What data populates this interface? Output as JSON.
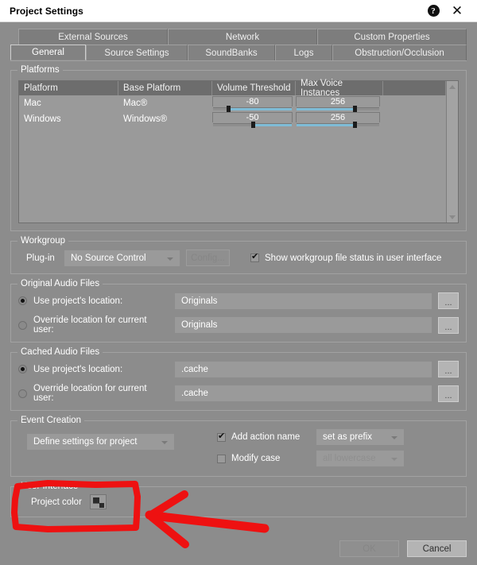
{
  "window": {
    "title": "Project Settings",
    "help_icon": "help-circle-icon",
    "help_label": "?",
    "close_label": "✕"
  },
  "tabs": {
    "row1": [
      {
        "label": "External Sources",
        "active": false
      },
      {
        "label": "Network",
        "active": false
      },
      {
        "label": "Custom Properties",
        "active": false
      }
    ],
    "row2": [
      {
        "label": "General",
        "active": true
      },
      {
        "label": "Source Settings",
        "active": false
      },
      {
        "label": "SoundBanks",
        "active": false
      },
      {
        "label": "Logs",
        "active": false
      },
      {
        "label": "Obstruction/Occlusion",
        "active": false
      }
    ]
  },
  "platforms": {
    "legend": "Platforms",
    "columns": [
      "Platform",
      "Base Platform",
      "Volume Threshold",
      "Max Voice Instances"
    ],
    "rows": [
      {
        "platform": "Mac",
        "base_platform": "Mac®",
        "volume_threshold": "-80",
        "volume_pct": 20,
        "max_voice_instances": "256",
        "voice_pct": 70
      },
      {
        "platform": "Windows",
        "base_platform": "Windows®",
        "volume_threshold": "-50",
        "volume_pct": 50,
        "max_voice_instances": "256",
        "voice_pct": 70
      }
    ],
    "scroll_up": "scroll-up-arrow-icon",
    "scroll_down": "scroll-down-arrow-icon"
  },
  "workgroup": {
    "legend": "Workgroup",
    "plugin_label": "Plug-in",
    "plugin_value": "No Source Control",
    "config_label": "Config...",
    "config_enabled": false,
    "show_status_label": "Show workgroup file status in user interface",
    "show_status_checked": true
  },
  "original_audio": {
    "legend": "Original Audio Files",
    "use_project_label": "Use project's location:",
    "use_project_selected": true,
    "use_project_value": "Originals",
    "override_label": "Override location for current user:",
    "override_selected": false,
    "override_value": "Originals",
    "browse_label": "..."
  },
  "cached_audio": {
    "legend": "Cached Audio Files",
    "use_project_label": "Use project's location:",
    "use_project_selected": true,
    "use_project_value": ".cache",
    "override_label": "Override location for current user:",
    "override_selected": false,
    "override_value": ".cache",
    "browse_label": "..."
  },
  "event_creation": {
    "legend": "Event Creation",
    "scope_value": "Define settings for project",
    "add_action_name_label": "Add action name",
    "add_action_name_checked": true,
    "add_action_name_mode": "set as prefix",
    "modify_case_label": "Modify case",
    "modify_case_checked": false,
    "modify_case_mode": "all lowercase",
    "modify_case_enabled": false
  },
  "user_interface": {
    "legend": "User Interface",
    "project_color_label": "Project color",
    "project_color_swatch": "color-swatch-icon"
  },
  "footer": {
    "ok_label": "OK",
    "ok_enabled": false,
    "cancel_label": "Cancel"
  },
  "annotations": {
    "highlight_color": "#ee1111",
    "rectangle_target": "user-interface-group",
    "arrow_direction": "left"
  }
}
